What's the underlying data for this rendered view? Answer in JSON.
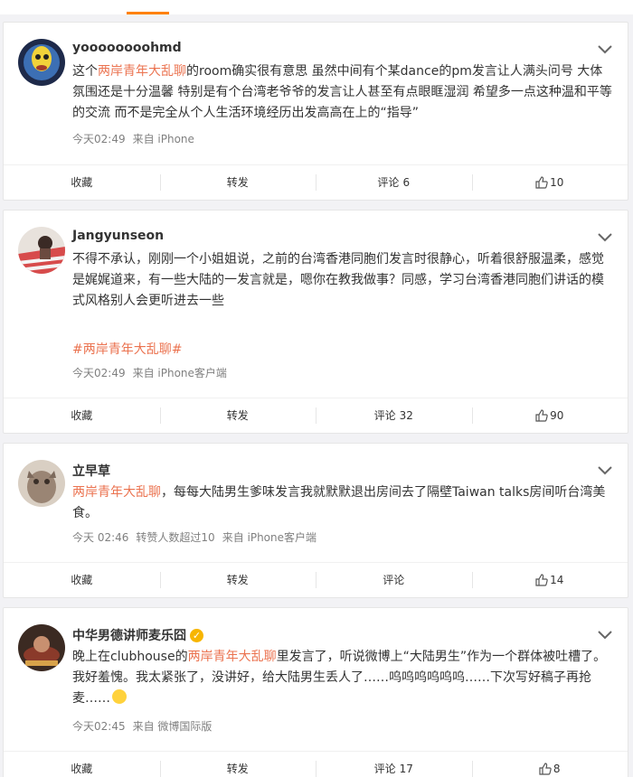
{
  "posts": [
    {
      "user": "yoooooooohmd",
      "content_pre": "这个",
      "topic": "两岸青年大乱聊",
      "content_post": "的room确实很有意思 虽然中间有个某dance的pm发言让人满头问号 大体氛围还是十分温馨 特别是有个台湾老爷爷的发言让人甚至有点眼眶湿润 希望多一点这种温和平等的交流 而不是完全从个人生活环境经历出发高高在上的“指导”",
      "time": "今天02:49",
      "source": "来自 iPhone",
      "actions": {
        "favorite": "收藏",
        "repost": "转发",
        "comment": "评论",
        "comment_count": "6",
        "like_count": "10"
      }
    },
    {
      "user": "Jangyunseon",
      "content": "不得不承认，刚刚一个小姐姐说，之前的台湾香港同胞们发言时很静心，听着很舒服温柔，感觉是娓娓道来，有一些大陆的一发言就是，嗯你在教我做事？同感，学习台湾香港同胞们讲话的模式风格别人会更听进去一些",
      "hashtag": "#两岸青年大乱聊#",
      "time": "今天02:49",
      "source": "来自 iPhone客户端",
      "actions": {
        "favorite": "收藏",
        "repost": "转发",
        "comment": "评论",
        "comment_count": "32",
        "like_count": "90"
      }
    },
    {
      "user": "立早草",
      "topic": "两岸青年大乱聊",
      "content_post": "，每每大陆男生爹味发言我就默默退出房间去了隔壁Taiwan talks房间听台湾美食。",
      "time": "今天 02:46",
      "extra": "转赞人数超过10",
      "source": "来自 iPhone客户端",
      "actions": {
        "favorite": "收藏",
        "repost": "转发",
        "comment": "评论",
        "like_count": "14"
      }
    },
    {
      "user": "中华男德讲师麦乐囧",
      "verified_icon": "verified-badge-icon",
      "content_pre": "晚上在clubhouse的",
      "topic": "两岸青年大乱聊",
      "content_post": "里发言了，听说微博上“大陆男生”作为一个群体被吐槽了。我好羞愧。我太紧张了，没讲好，给大陆男生丢人了……呜呜呜呜呜呜……下次写好稿子再抢麦……",
      "emoji": "crying-face-icon",
      "time": "今天02:45",
      "source": "来自 微博国际版",
      "actions": {
        "favorite": "收藏",
        "repost": "转发",
        "comment": "评论",
        "comment_count": "17",
        "like_count": "8"
      }
    }
  ],
  "colors": {
    "topic": "#eb7350",
    "tab_indicator": "#ff8200",
    "verified": "#f7b500"
  }
}
